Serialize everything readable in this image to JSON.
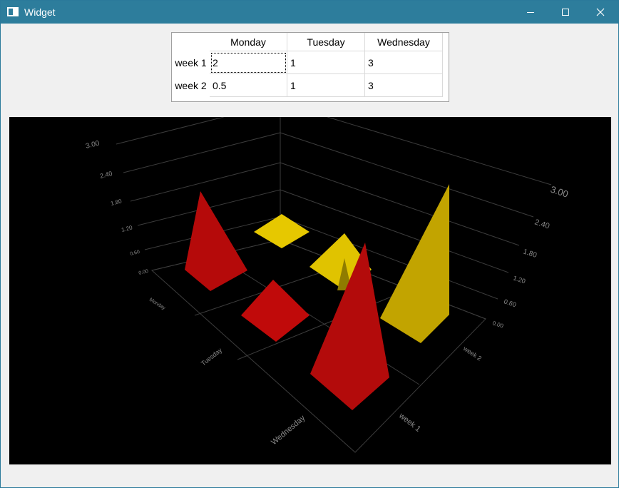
{
  "window": {
    "title": "Widget"
  },
  "table": {
    "columns": [
      "Monday",
      "Tuesday",
      "Wednesday"
    ],
    "rows": [
      {
        "label": "week 1",
        "values": [
          "2",
          "1",
          "3"
        ]
      },
      {
        "label": "week 2",
        "values": [
          "0.5",
          "1",
          "3"
        ]
      }
    ]
  },
  "chart_data": {
    "type": "bar3d",
    "bar_shape": "pyramid",
    "rows": [
      "week 1",
      "week 2"
    ],
    "columns": [
      "Monday",
      "Tuesday",
      "Wednesday"
    ],
    "series": [
      {
        "name": "week 1",
        "values": [
          2,
          1,
          3
        ]
      },
      {
        "name": "week 2",
        "values": [
          0.5,
          1,
          3
        ]
      }
    ],
    "value_ticks": [
      "0.00",
      "0.60",
      "1.20",
      "1.80",
      "2.40",
      "3.00"
    ],
    "ylim": [
      0,
      3
    ],
    "colors": {
      "red": "#c00a0a",
      "yellow": "#e5c800",
      "background": "#000000",
      "grid": "#3c3c3c"
    }
  }
}
